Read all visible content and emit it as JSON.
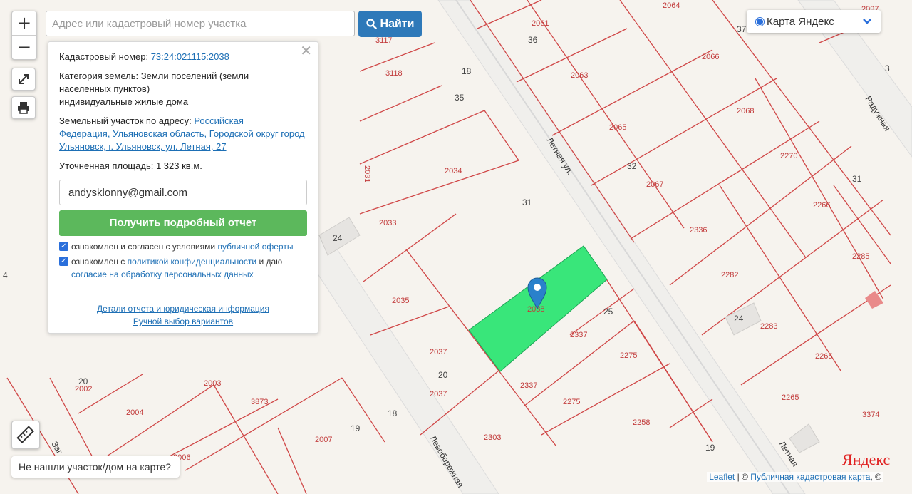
{
  "search": {
    "placeholder": "Адрес или кадастровый номер участка",
    "button_label": "Найти"
  },
  "zoom": {
    "in": "+",
    "out": "−"
  },
  "layer_select": {
    "value": "Карта Яндекс"
  },
  "info_panel": {
    "cadastral_label": "Кадастровый номер:",
    "cadastral_number": "73:24:021115:2038",
    "category_label": "Категория земель:",
    "category_value_line1": "Земли поселений (земли",
    "category_value_line2": "населенных пунктов)",
    "category_value_line3": "индивидуальные жилые дома",
    "address_label": "Земельный участок по адресу:",
    "address_value_line1": "Российская",
    "address_value_line2": "Федерация, Ульяновская область, Городской округ город",
    "address_value_line3": "Ульяновск, г. Ульяновск, ул. Летная, 27",
    "area_label": "Уточненная площадь:",
    "area_value": "1 323 кв.м.",
    "email_value": "andysklonny@gmail.com",
    "report_button": "Получить подробный отчет",
    "consent1_prefix": "ознакомлен и согласен с условиями",
    "consent1_link": "публичной оферты",
    "consent2_prefix": "ознакомлен с",
    "consent2_link1": "политикой конфиденциальности",
    "consent2_mid": "и даю",
    "consent2_link2": "согласие на обработку персональных данных",
    "link_details": "Детали отчета и юридическая информация",
    "link_manual": "Ручной выбор вариантов"
  },
  "not_found_label": "Не нашли участок/дом на карте?",
  "attribution": {
    "leaflet": "Leaflet",
    "sep": " | © ",
    "source": "Публичная кадастровая карта",
    "tail": ", ©"
  },
  "yandex_logo": {
    "first": "Я",
    "rest": "ндекс"
  },
  "map": {
    "colors": {
      "parcel_line": "#d04747",
      "selected_fill": "#39e67a",
      "marker": "#2a81cb",
      "road": "#e8e8e8"
    },
    "streets": [
      "Летная ул.",
      "Радужная",
      "Летная",
      "Левобережная",
      "Заг"
    ],
    "parcel_labels": [
      "2061",
      "2064",
      "2097",
      "2063",
      "2066",
      "2065",
      "2068",
      "2067",
      "2270",
      "2266",
      "2336",
      "2282",
      "2285",
      "2283",
      "2265",
      "3374",
      "2275",
      "2258",
      "2337",
      "2038",
      "2037",
      "2035",
      "2033",
      "2034",
      "2031",
      "3117",
      "3118",
      "2002",
      "2003",
      "2004",
      "3873",
      "2007",
      "2006",
      "2303"
    ],
    "house_numbers": [
      "36",
      "37",
      "18",
      "35",
      "31",
      "32",
      "31",
      "3",
      "24",
      "25",
      "24",
      "20",
      "18",
      "19",
      "19",
      "20",
      "4"
    ]
  }
}
